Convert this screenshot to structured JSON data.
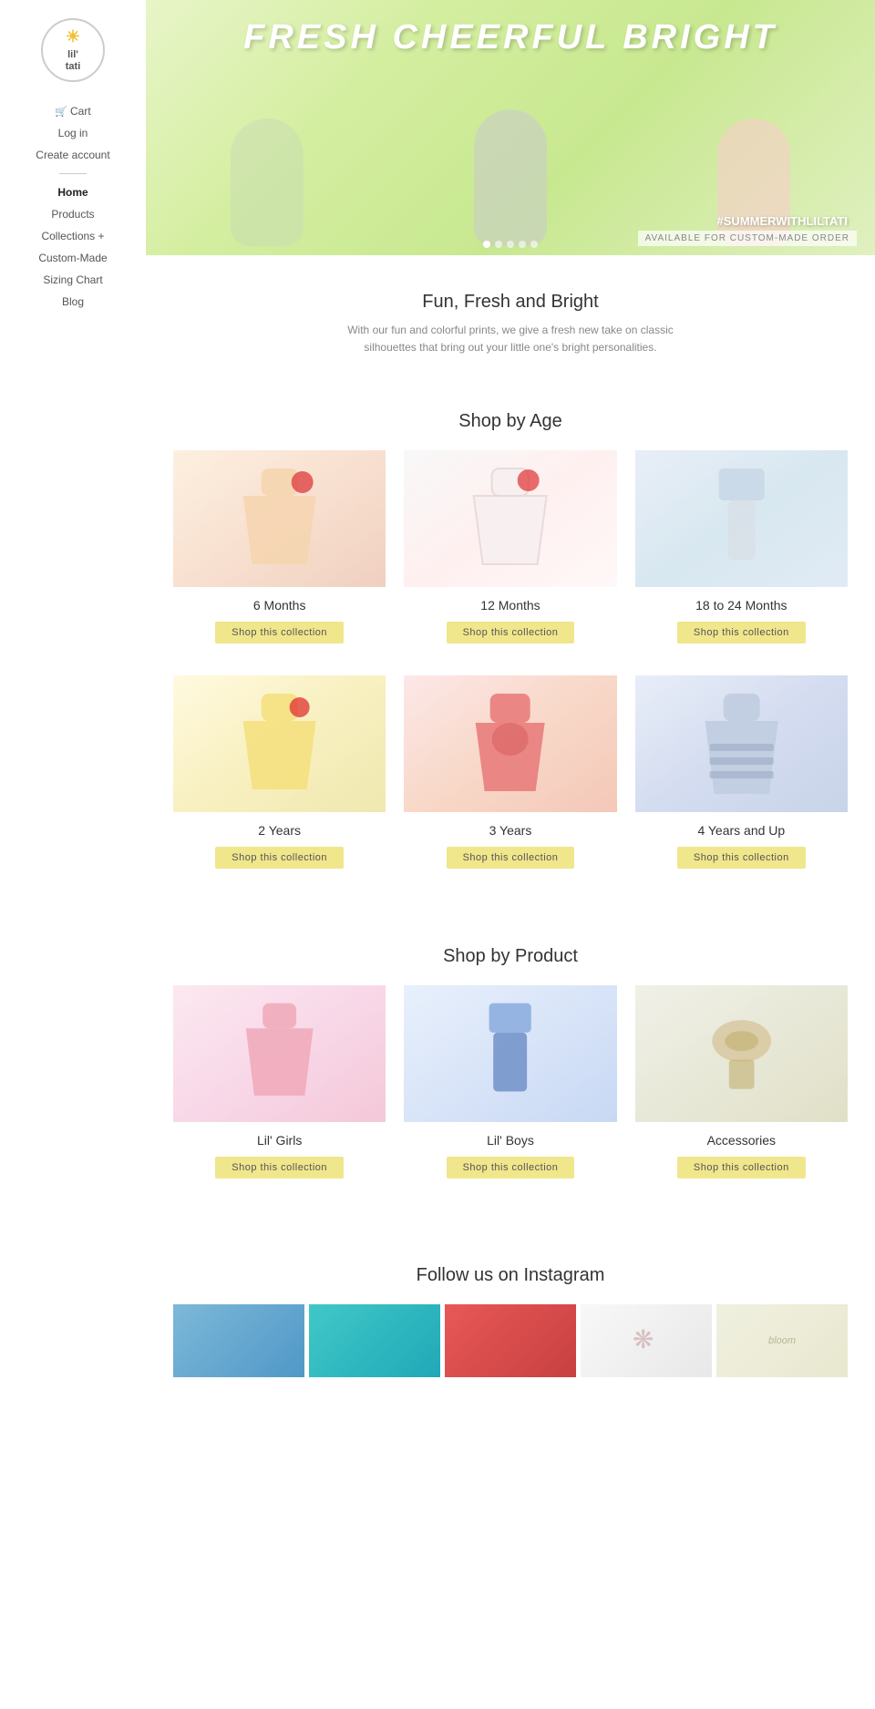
{
  "site": {
    "logo_line1": "lil'",
    "logo_line2": "tati"
  },
  "sidebar": {
    "cart_label": "Cart",
    "login_label": "Log in",
    "create_account_label": "Create account",
    "nav_items": [
      {
        "label": "Home",
        "active": true
      },
      {
        "label": "Products",
        "active": false
      },
      {
        "label": "Collections +",
        "active": false
      },
      {
        "label": "Custom-Made",
        "active": false
      },
      {
        "label": "Sizing Chart",
        "active": false
      },
      {
        "label": "Blog",
        "active": false
      }
    ]
  },
  "hero": {
    "title": "FRESH  CHEERFUL  BRIGHT",
    "hashtag": "#SUMMERWITHLILTATI",
    "subtitle": "AVAILABLE FOR CUSTOM-MADE ORDER",
    "dots_count": 5
  },
  "intro": {
    "title": "Fun, Fresh and Bright",
    "subtitle": "With our fun and colorful prints, we give a fresh new take on classic silhouettes that bring out your little one's bright personalities."
  },
  "shop_by_age": {
    "section_title": "Shop by Age",
    "items": [
      {
        "label": "6 Months",
        "btn": "Shop this collection",
        "img_class": "img-6mo"
      },
      {
        "label": "12 Months",
        "btn": "Shop this collection",
        "img_class": "img-12mo"
      },
      {
        "label": "18 to 24 Months",
        "btn": "Shop this collection",
        "img_class": "img-1824mo"
      },
      {
        "label": "2 Years",
        "btn": "Shop this collection",
        "img_class": "img-2yr"
      },
      {
        "label": "3 Years",
        "btn": "Shop this collection",
        "img_class": "img-3yr"
      },
      {
        "label": "4 Years and Up",
        "btn": "Shop this collection",
        "img_class": "img-4yr"
      }
    ]
  },
  "shop_by_product": {
    "section_title": "Shop by Product",
    "items": [
      {
        "label": "Lil' Girls",
        "btn": "Shop this collection",
        "img_class": "img-girls"
      },
      {
        "label": "Lil' Boys",
        "btn": "Shop this collection",
        "img_class": "img-boys"
      },
      {
        "label": "Accessories",
        "btn": "Shop this collection",
        "img_class": "img-acc"
      }
    ]
  },
  "instagram": {
    "section_title": "Follow us on Instagram",
    "thumbs": [
      {
        "class": "ig1"
      },
      {
        "class": "ig2"
      },
      {
        "class": "ig3"
      },
      {
        "class": "ig4"
      },
      {
        "class": "ig5"
      }
    ]
  }
}
